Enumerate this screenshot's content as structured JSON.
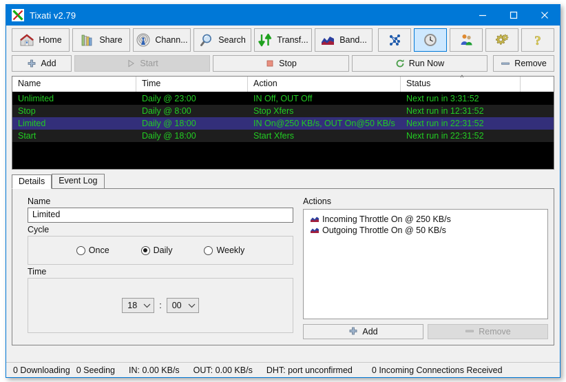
{
  "window": {
    "title": "Tixati v2.79",
    "logo_icon": "tixati-x-logo",
    "controls": {
      "minimize": "minimize-icon",
      "maximize": "maximize-icon",
      "close": "close-icon"
    },
    "accent": "#0078d7"
  },
  "toolbar": {
    "buttons": [
      {
        "label": "Home",
        "icon": "house-icon",
        "selected": false,
        "kind": "labelled"
      },
      {
        "label": "Share",
        "icon": "books-icon",
        "selected": false,
        "kind": "labelled"
      },
      {
        "label": "Chann...",
        "icon": "antenna-icon",
        "selected": false,
        "kind": "labelled"
      },
      {
        "label": "Search",
        "icon": "magnifier-icon",
        "selected": false,
        "kind": "labelled"
      },
      {
        "label": "Transf...",
        "icon": "up-down-arrows-icon",
        "selected": false,
        "kind": "labelled"
      },
      {
        "label": "Band...",
        "icon": "bandwidth-graph-icon",
        "selected": false,
        "kind": "labelled"
      },
      {
        "label": "",
        "icon": "peers-network-icon",
        "selected": false,
        "kind": "icononly"
      },
      {
        "label": "",
        "icon": "clock-icon",
        "selected": true,
        "kind": "icononly"
      },
      {
        "label": "",
        "icon": "users-icon",
        "selected": false,
        "kind": "icononly"
      },
      {
        "label": "",
        "icon": "gears-icon",
        "selected": false,
        "kind": "icononly"
      },
      {
        "label": "",
        "icon": "question-mark-icon",
        "selected": false,
        "kind": "icononly"
      }
    ]
  },
  "action_row": {
    "add": {
      "label": "Add",
      "icon": "plus-icon",
      "disabled": false
    },
    "start": {
      "label": "Start",
      "icon": "play-triangle-icon",
      "disabled": true
    },
    "stop": {
      "label": "Stop",
      "icon": "stop-square-icon",
      "disabled": false
    },
    "run_now": {
      "label": "Run Now",
      "icon": "refresh-icon",
      "disabled": false
    },
    "remove": {
      "label": "Remove",
      "icon": "minus-icon",
      "disabled": false
    }
  },
  "table": {
    "columns": [
      "Name",
      "Time",
      "Action",
      "Status",
      ""
    ],
    "sorted_column": "Status",
    "sort_indicator": "^",
    "rows": [
      {
        "name": "Unlimited",
        "time": "Daily @ 23:00",
        "action": "IN Off, OUT Off",
        "status": "Next run in 3:31:52",
        "selected": false
      },
      {
        "name": "Stop",
        "time": "Daily @ 8:00",
        "action": "Stop Xfers",
        "status": "Next run in 12:31:52",
        "selected": false
      },
      {
        "name": "Limited",
        "time": "Daily @ 18:00",
        "action": "IN On@250 KB/s, OUT On@50 KB/s",
        "status": "Next run in 22:31:52",
        "selected": true
      },
      {
        "name": "Start",
        "time": "Daily @ 18:00",
        "action": "Start Xfers",
        "status": "Next run in 22:31:52",
        "selected": false
      }
    ],
    "row_text_color": "#22cc22",
    "selected_row_color": "#332f7a"
  },
  "tabs": [
    {
      "label": "Details",
      "active": true
    },
    {
      "label": "Event Log",
      "active": false
    }
  ],
  "details": {
    "name_label": "Name",
    "name_value": "Limited",
    "cycle_label": "Cycle",
    "cycle_options": [
      {
        "label": "Once",
        "checked": false
      },
      {
        "label": "Daily",
        "checked": true
      },
      {
        "label": "Weekly",
        "checked": false
      }
    ],
    "time_label": "Time",
    "time_hour": "18",
    "time_minute": "00",
    "time_separator": ":"
  },
  "actions_panel": {
    "label": "Actions",
    "items": [
      {
        "text": "Incoming Throttle On @ 250 KB/s",
        "icon": "bandwidth-graph-icon"
      },
      {
        "text": "Outgoing Throttle On @ 50 KB/s",
        "icon": "bandwidth-graph-icon"
      }
    ],
    "add_button": {
      "label": "Add",
      "icon": "plus-icon",
      "disabled": false
    },
    "remove_button": {
      "label": "Remove",
      "icon": "minus-icon",
      "disabled": true
    }
  },
  "statusbar": {
    "downloading": "0 Downloading",
    "seeding": "0 Seeding",
    "incoming_rate": "IN: 0.00 KB/s",
    "outgoing_rate": "OUT: 0.00 KB/s",
    "dht": "DHT: port unconfirmed",
    "connections": "0 Incoming Connections Received"
  }
}
